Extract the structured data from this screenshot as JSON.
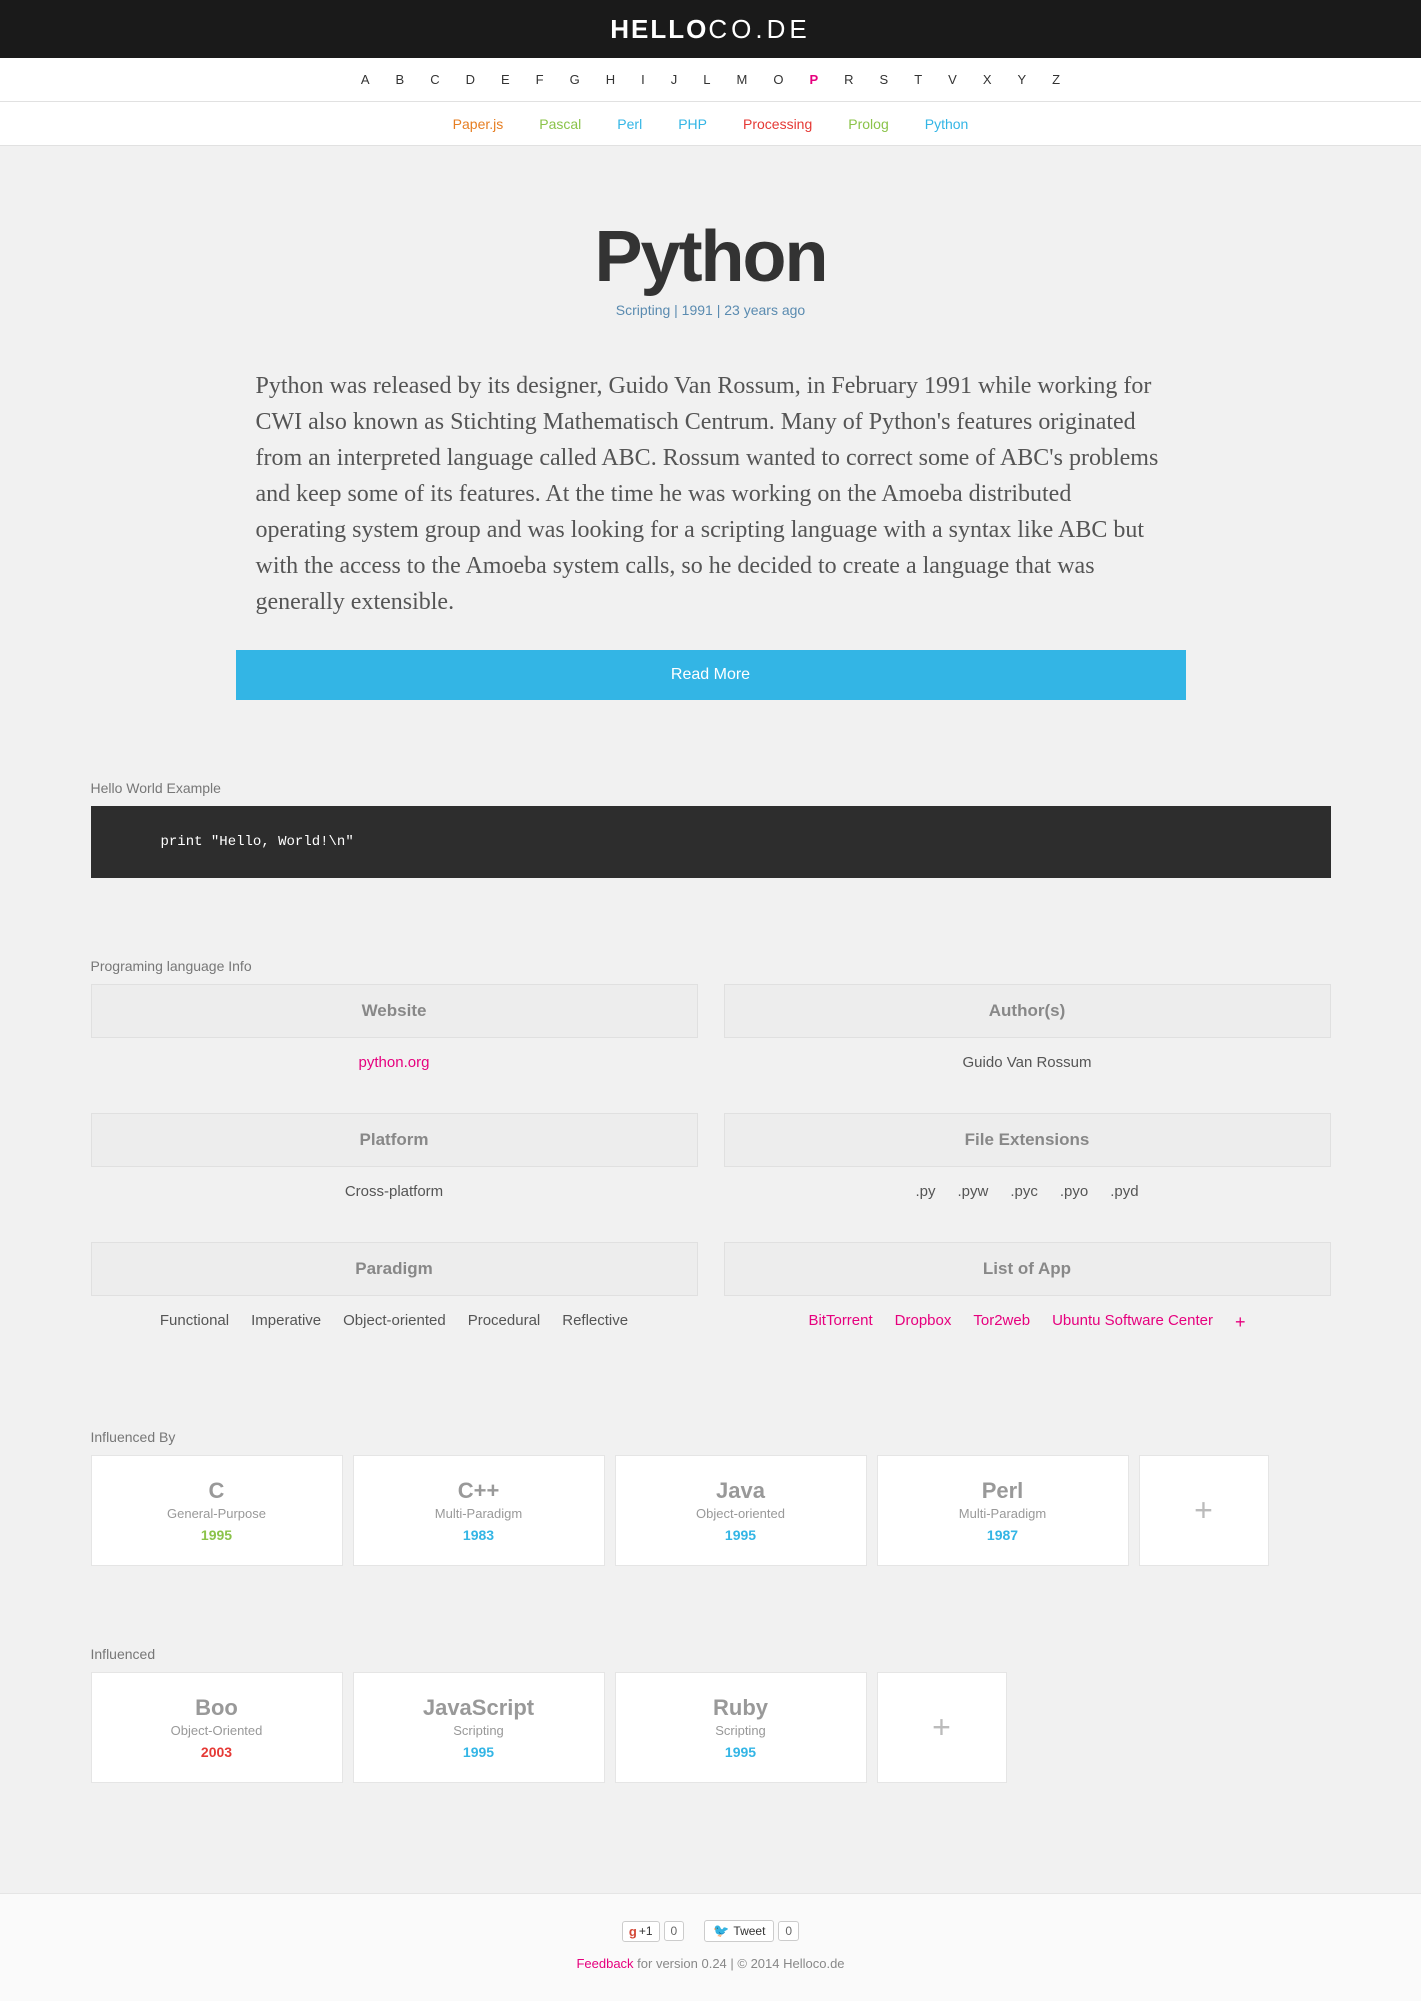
{
  "logo": {
    "bold": "HELLO",
    "thin": "CO.DE"
  },
  "alpha": {
    "letters": [
      "A",
      "B",
      "C",
      "D",
      "E",
      "F",
      "G",
      "H",
      "I",
      "J",
      "L",
      "M",
      "O",
      "P",
      "R",
      "S",
      "T",
      "V",
      "X",
      "Y",
      "Z"
    ],
    "active": "P"
  },
  "subnav": [
    {
      "label": "Paper.js",
      "color": "#e67e22"
    },
    {
      "label": "Pascal",
      "color": "#8bc34a"
    },
    {
      "label": "Perl",
      "color": "#33b5e5"
    },
    {
      "label": "PHP",
      "color": "#33b5e5"
    },
    {
      "label": "Processing",
      "color": "#e53935"
    },
    {
      "label": "Prolog",
      "color": "#8bc34a"
    },
    {
      "label": "Python",
      "color": "#33b5e5"
    }
  ],
  "title": {
    "name": "Python",
    "meta": "Scripting | 1991 | 23 years ago"
  },
  "intro": "Python was released by its designer, Guido Van Rossum, in February 1991 while working for CWI also known as Stichting Mathematisch Centrum. Many of Python's features originated from an interpreted language called ABC. Rossum wanted to correct some of ABC's problems and keep some of its features. At the time he was working on the Amoeba distributed operating system group and was looking for a scripting language with a syntax like ABC but with the access to the Amoeba system calls, so he decided to create a language that was generally extensible.",
  "read_more": "Read More",
  "hello_world": {
    "label": "Hello World Example",
    "code": "print \"Hello, World!\\n\""
  },
  "info": {
    "label": "Programing language Info",
    "cells": [
      {
        "head": "Website",
        "body_html": "<a href='#'>python.org</a>"
      },
      {
        "head": "Author(s)",
        "body_html": "<span>Guido Van Rossum</span>"
      },
      {
        "head": "Platform",
        "body_html": "<span>Cross-platform</span>"
      },
      {
        "head": "File Extensions",
        "body_html": "<span>.py</span><span>.pyw</span><span>.pyc</span><span>.pyo</span><span>.pyd</span>"
      },
      {
        "head": "Paradigm",
        "body_html": "<span>Functional</span><span>Imperative</span><span>Object-oriented</span><span>Procedural</span><span>Reflective</span>"
      },
      {
        "head": "List of App",
        "body_html": "<a href='#'>BitTorrent</a><a href='#'>Dropbox</a><a href='#'>Tor2web</a><a href='#'>Ubuntu Software Center</a><span class='plus-mini'>+</span>"
      }
    ]
  },
  "influenced_by": {
    "label": "Influenced By",
    "cards": [
      {
        "name": "C",
        "tag": "General-Purpose",
        "year": "1995",
        "year_class": "year-green"
      },
      {
        "name": "C++",
        "tag": "Multi-Paradigm",
        "year": "1983",
        "year_class": "year-blue"
      },
      {
        "name": "Java",
        "tag": "Object-oriented",
        "year": "1995",
        "year_class": "year-blue"
      },
      {
        "name": "Perl",
        "tag": "Multi-Paradigm",
        "year": "1987",
        "year_class": "year-blue"
      }
    ]
  },
  "influenced": {
    "label": "Influenced",
    "cards": [
      {
        "name": "Boo",
        "tag": "Object-Oriented",
        "year": "2003",
        "year_class": "year-red"
      },
      {
        "name": "JavaScript",
        "tag": "Scripting",
        "year": "1995",
        "year_class": "year-blue"
      },
      {
        "name": "Ruby",
        "tag": "Scripting",
        "year": "1995",
        "year_class": "year-blue"
      }
    ]
  },
  "footer": {
    "gplus": "+1",
    "gplus_count": "0",
    "tweet": "Tweet",
    "tweet_count": "0",
    "feedback": "Feedback",
    "rest": " for version 0.24 | © 2014 Helloco.de"
  }
}
